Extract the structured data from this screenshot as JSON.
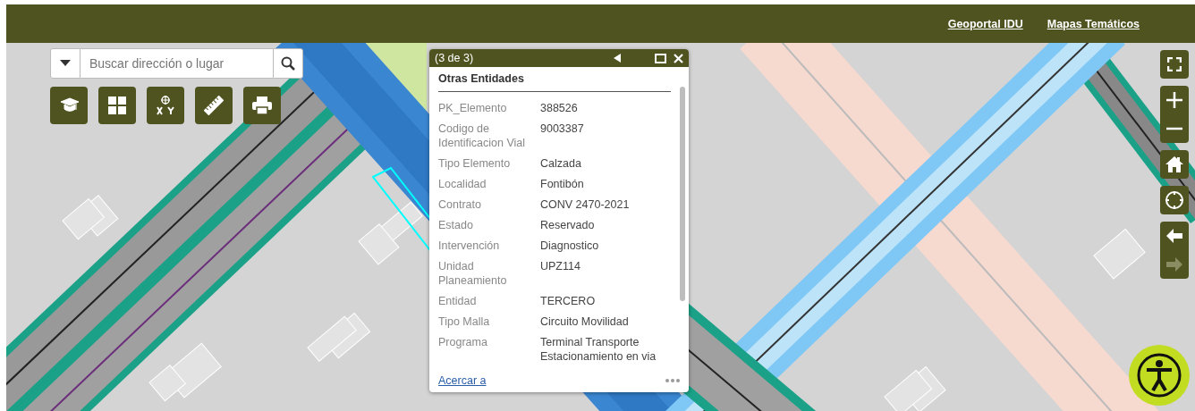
{
  "header": {
    "links": [
      "Geoportal IDU",
      "Mapas Temáticos"
    ]
  },
  "search": {
    "placeholder": "Buscar dirección o lugar"
  },
  "tools": [
    {
      "kind": "education"
    },
    {
      "kind": "grid"
    },
    {
      "kind": "xy"
    },
    {
      "kind": "ruler"
    },
    {
      "kind": "printer"
    }
  ],
  "popup": {
    "title": "(3 de 3)",
    "section": "Otras Entidades",
    "link": "Acercar a",
    "fields": [
      {
        "label": "PK_Elemento",
        "value": "388526"
      },
      {
        "label": "Codigo de Identificacion Vial",
        "value": "9003387"
      },
      {
        "label": "Tipo Elemento",
        "value": "Calzada"
      },
      {
        "label": "Localidad",
        "value": "Fontibón"
      },
      {
        "label": "Contrato",
        "value": "CONV 2470-2021"
      },
      {
        "label": "Estado",
        "value": "Reservado"
      },
      {
        "label": "Intervención",
        "value": "Diagnostico"
      },
      {
        "label": "Unidad Planeamiento",
        "value": "UPZ114"
      },
      {
        "label": "Entidad",
        "value": "TERCERO"
      },
      {
        "label": "Tipo Malla",
        "value": "Circuito Movilidad"
      },
      {
        "label": "Programa",
        "value": "Terminal Transporte Estacionamiento en via"
      }
    ]
  },
  "nav": [
    {
      "kind": "back",
      "disabled": false
    },
    {
      "kind": "forward",
      "disabled": true
    }
  ]
}
